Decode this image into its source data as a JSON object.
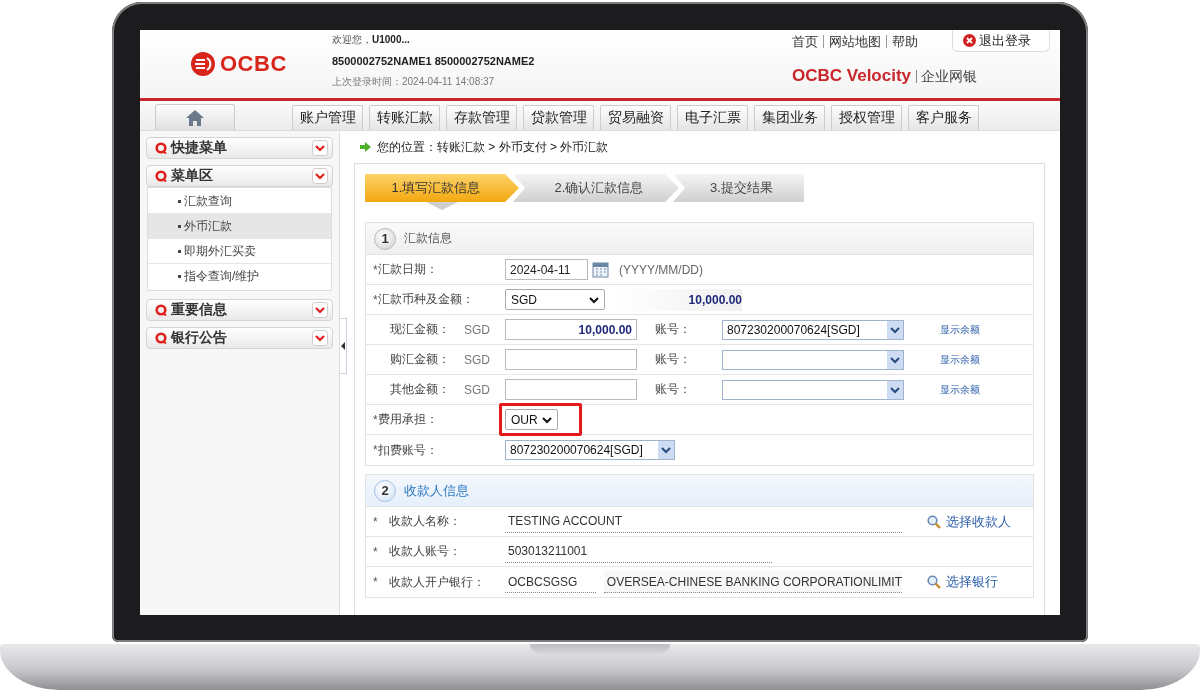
{
  "header": {
    "logo": "OCBC",
    "welcome": "欢迎您，**U1000...**",
    "account_names": "8500002752NAME1 8500002752NAME2",
    "last_login": "上次登录时间：2024-04-11 14:08:37",
    "top_links": [
      "首页",
      "网站地图",
      "帮助"
    ],
    "logout": "退出登录",
    "brand": "OCBC Velocity",
    "brand_sub": "企业网银"
  },
  "nav": {
    "tabs": [
      "账户管理",
      "转账汇款",
      "存款管理",
      "贷款管理",
      "贸易融资",
      "电子汇票",
      "集团业务",
      "授权管理",
      "客户服务"
    ]
  },
  "sidebar": {
    "sections": [
      {
        "title": "快捷菜单"
      },
      {
        "title": "菜单区",
        "items": [
          {
            "label": "汇款查询",
            "selected": false
          },
          {
            "label": "外币汇款",
            "selected": true
          },
          {
            "label": "即期外汇买卖",
            "selected": false
          },
          {
            "label": "指令查询/维护",
            "selected": false
          }
        ]
      },
      {
        "title": "重要信息"
      },
      {
        "title": "银行公告"
      }
    ]
  },
  "breadcrumb": "您的位置：转账汇款 > 外币支付 > 外币汇款",
  "steps": [
    {
      "label": "1.填写汇款信息",
      "selected": true
    },
    {
      "label": "2.确认汇款信息",
      "selected": false
    },
    {
      "label": "3.提交结果",
      "selected": false
    }
  ],
  "sections": [
    {
      "number": "1",
      "title": "汇款信息",
      "active": false,
      "rows": [
        {
          "kind": "date",
          "mark": "*",
          "label": "汇款日期：",
          "value": "2024-04-11",
          "hint": "(YYYY/MM/DD)"
        },
        {
          "kind": "currency",
          "mark": "*",
          "label": "汇款币种及金额：",
          "currency": "SGD",
          "amount": "10,000.00"
        },
        {
          "kind": "amount",
          "label": "现汇金额：",
          "currency": "SGD",
          "amount": "10,000.00",
          "account_label": "账号：",
          "account": "807230200070624[SGD]",
          "link": "显示余额"
        },
        {
          "kind": "amount",
          "label": "购汇金额：",
          "currency": "SGD",
          "account_label": "账号：",
          "link": "显示余额"
        },
        {
          "kind": "amount",
          "label": "其他金额：",
          "currency": "SGD",
          "account_label": "账号：",
          "link": "显示余额"
        },
        {
          "kind": "select",
          "mark": "*",
          "label": "费用承担：",
          "value": "OUR",
          "highlighted": true
        },
        {
          "kind": "account_select",
          "mark": "*",
          "label": "扣费账号：",
          "value": "807230200070624[SGD]"
        }
      ]
    },
    {
      "number": "2",
      "title": "收款人信息",
      "active": true,
      "rows": [
        {
          "kind": "payee",
          "mark": "*",
          "label": "收款人名称：",
          "values": [
            "TESTING ACCOUNT"
          ],
          "action": "选择收款人"
        },
        {
          "kind": "payee",
          "mark": "*",
          "label": "收款人账号：",
          "values": [
            "503013211001"
          ]
        },
        {
          "kind": "payee",
          "mark": "*",
          "label": "收款人开户银行：",
          "values": [
            "OCBCSGSG",
            "OVERSEA-CHINESE BANKING CORPORATIONLIMIT"
          ],
          "action": "选择银行"
        }
      ]
    }
  ]
}
